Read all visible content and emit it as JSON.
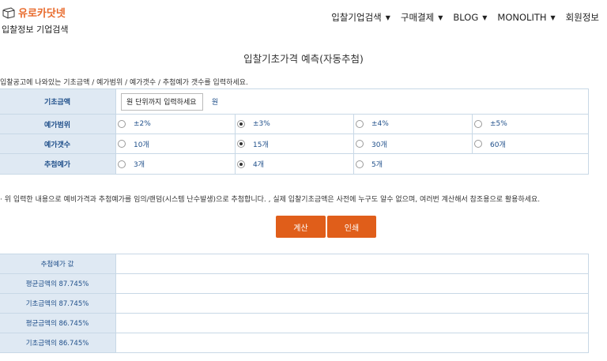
{
  "header": {
    "logo_text": "유로카닷넷",
    "logo_sub": "입찰정보 기업검색",
    "nav": [
      {
        "label": "입찰기업검색",
        "has_caret": true
      },
      {
        "label": "구매결제",
        "has_caret": true
      },
      {
        "label": "BLOG",
        "has_caret": true
      },
      {
        "label": "MONOLITH",
        "has_caret": true
      },
      {
        "label": "회원정보",
        "has_caret": false
      }
    ]
  },
  "page_title": "입찰기초가격 예측(자동추첨)",
  "instruction": "입찰공고에 나와있는 기초금액 / 예가범위 / 예가갯수 / 추첨예가 갯수를 입력하세요.",
  "form": {
    "amount": {
      "label": "기초금액",
      "placeholder": "원 단위까지 입력하세요",
      "unit": "원"
    },
    "range": {
      "label": "예가범위",
      "options": [
        "±2%",
        "±3%",
        "±4%",
        "±5%"
      ],
      "selected": 1
    },
    "count": {
      "label": "예가갯수",
      "options": [
        "10개",
        "15개",
        "30개",
        "60개"
      ],
      "selected": 1
    },
    "draw": {
      "label": "추첨예가",
      "options": [
        "3개",
        "4개",
        "5개"
      ],
      "selected": 1
    }
  },
  "note": "· 위 입력한 내용으로 예비가격과 추첨예가를 임의/랜덤(시스템 난수발생)으로 추첨합니다. , 실제 입찰기초금액은 사전에 누구도 알수 없으며, 여러번 계산해서 참조용으로 활용하세요.",
  "buttons": {
    "calc": "계산",
    "print": "인쇄"
  },
  "results": [
    "추첨예가 값",
    "평균금액의 87.745%",
    "기초금액의 87.745%",
    "평균금액의 86.745%",
    "기초금액의 86.745%"
  ],
  "colors": {
    "accent": "#e05e1a",
    "label_bg": "#dfe9f3",
    "label_text": "#1f4f8a",
    "logo": "#e8692a"
  }
}
